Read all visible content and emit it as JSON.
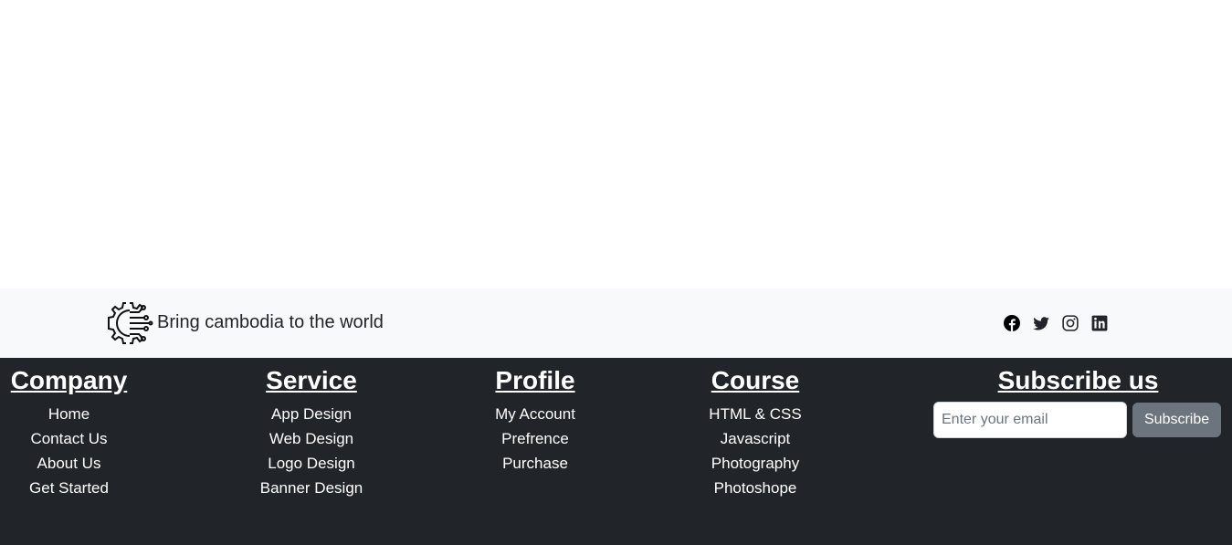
{
  "brand": {
    "tagline": "Bring cambodia to the world",
    "logo_icon": "circuit-gear-logo"
  },
  "socials": [
    {
      "name": "facebook-icon",
      "color": "#000000"
    },
    {
      "name": "twitter-icon",
      "color": "#212529"
    },
    {
      "name": "instagram-icon",
      "color": "#212529"
    },
    {
      "name": "linkedin-icon",
      "color": "#212529"
    }
  ],
  "footer": {
    "company": {
      "title": "Company",
      "items": [
        "Home",
        "Contact Us",
        "About Us",
        "Get Started"
      ]
    },
    "service": {
      "title": "Service",
      "items": [
        "App Design",
        "Web Design",
        "Logo Design",
        "Banner Design"
      ]
    },
    "profile": {
      "title": "Profile",
      "items": [
        "My Account",
        "Prefrence",
        "Purchase"
      ]
    },
    "course": {
      "title": "Course",
      "items": [
        "HTML & CSS",
        "Javascript",
        "Photography",
        "Photoshope"
      ]
    },
    "subscribe": {
      "title": "Subscribe us",
      "placeholder": "Enter your email",
      "button": "Subscribe"
    }
  },
  "colors": {
    "footer_bg": "#212529",
    "brand_bar_bg": "#f8f9fa",
    "button_bg": "#6c757d"
  }
}
